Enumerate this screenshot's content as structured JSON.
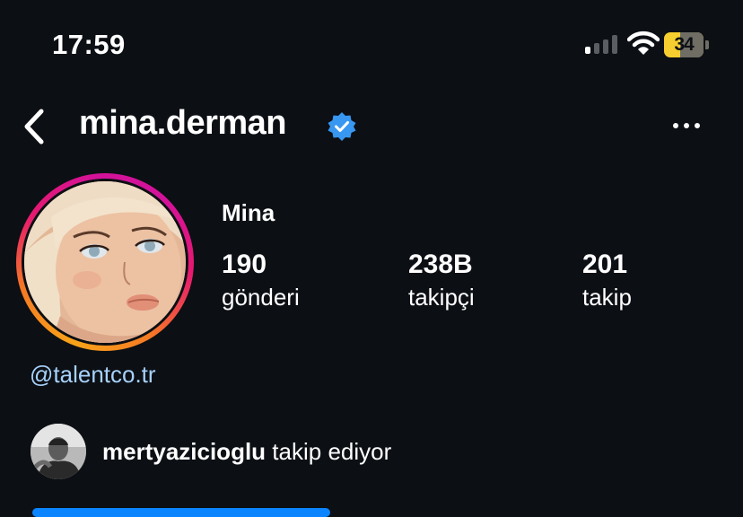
{
  "status_bar": {
    "time": "17:59",
    "battery_level": "34"
  },
  "header": {
    "username": "mina.derman"
  },
  "profile": {
    "display_name": "Mina",
    "stats": [
      {
        "value": "190",
        "label": "gönderi"
      },
      {
        "value": "238B",
        "label": "takipçi"
      },
      {
        "value": "201",
        "label": "takip"
      }
    ],
    "bio_link": "@talentco.tr"
  },
  "followed_by": {
    "user": "mertyazicioglu",
    "suffix": "takip ediyor"
  },
  "colors": {
    "background": "#0c0f14",
    "link": "#a6d1fb",
    "verified": "#3897f0",
    "battery": "#f7ce2f"
  },
  "icons": [
    "back-chevron-icon",
    "verified-badge-icon",
    "more-dots-icon",
    "signal-icon",
    "wifi-icon",
    "battery-icon"
  ]
}
